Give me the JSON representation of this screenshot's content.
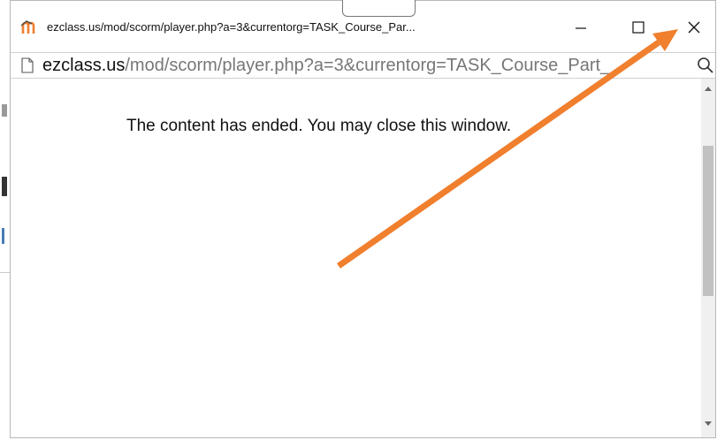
{
  "window": {
    "title": "ezclass.us/mod/scorm/player.php?a=3&currentorg=TASK_Course_Par...",
    "minimize_label": "—",
    "maximize_label": "☐",
    "close_label": "✕"
  },
  "address_bar": {
    "host": "ezclass.us",
    "path": "/mod/scorm/player.php?a=3&currentorg=TASK_Course_Part_"
  },
  "content": {
    "message": "The content has ended. You may close this window."
  },
  "annotation": {
    "arrow_color": "#f07f2e",
    "points_to": "close-button"
  },
  "colors": {
    "brand_icon": "#f07f2e",
    "window_border": "#b7b7b7",
    "scrollbar_thumb": "#c1c1c1"
  }
}
